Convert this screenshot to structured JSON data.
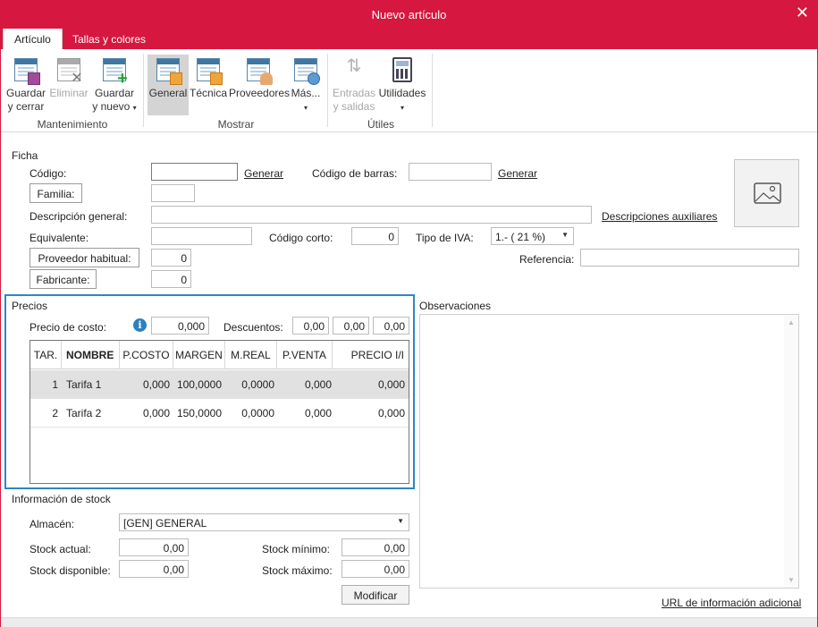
{
  "window": {
    "title": "Nuevo artículo",
    "close_glyph": "✕"
  },
  "tabs": [
    {
      "label": "Artículo",
      "active": true
    },
    {
      "label": "Tallas y colores",
      "active": false
    }
  ],
  "ribbon": {
    "buttons": {
      "guardar_cerrar": {
        "line1": "Guardar",
        "line2": "y cerrar",
        "icon": "save-close-icon"
      },
      "eliminar": {
        "line1": "Eliminar",
        "line2": "",
        "icon": "delete-icon",
        "disabled": true
      },
      "guardar_nuevo": {
        "line1": "Guardar",
        "line2": "y nuevo",
        "caret": "▾",
        "icon": "save-new-icon"
      },
      "general": {
        "line1": "General",
        "icon": "general-icon",
        "selected": true
      },
      "tecnica": {
        "line1": "Técnica",
        "icon": "technical-icon"
      },
      "proveedores": {
        "line1": "Proveedores",
        "icon": "suppliers-icon"
      },
      "mas": {
        "line1": "Más...",
        "caret": "▾",
        "icon": "more-icon"
      },
      "entradas": {
        "line1": "Entradas",
        "line2": "y salidas",
        "icon": "in-out-icon",
        "disabled": true
      },
      "utilidades": {
        "line1": "Utilidades",
        "caret": "▾",
        "icon": "calculator-icon"
      }
    },
    "groups": {
      "mantenimiento": "Mantenimiento",
      "mostrar": "Mostrar",
      "utiles": "Útiles"
    }
  },
  "ficha": {
    "section": "Ficha",
    "codigo_label": "Código:",
    "codigo_value": "",
    "generar": "Generar",
    "codigo_barras_label": "Código de barras:",
    "codigo_barras_value": "",
    "generar2": "Generar",
    "familia_button": "Familia:",
    "familia_value": "",
    "descripcion_label": "Descripción general:",
    "descripcion_value": "",
    "descripciones_aux": "Descripciones auxiliares",
    "equivalente_label": "Equivalente:",
    "equivalente_value": "",
    "codigo_corto_label": "Código corto:",
    "codigo_corto_value": "0",
    "tipo_iva_label": "Tipo de IVA:",
    "tipo_iva_value": "1.- ( 21 %)",
    "proveedor_button": "Proveedor habitual:",
    "proveedor_value": "0",
    "referencia_label": "Referencia:",
    "referencia_value": "",
    "fabricante_button": "Fabricante:",
    "fabricante_value": "0",
    "image_icon": "image-placeholder-icon"
  },
  "precios": {
    "section": "Precios",
    "precio_costo_label": "Precio de costo:",
    "precio_costo_value": "0,000",
    "info_glyph": "i",
    "descuentos_label": "Descuentos:",
    "descuentos": [
      "0,00",
      "0,00",
      "0,00"
    ],
    "columns": [
      "TAR.",
      "NOMBRE",
      "P.COSTO",
      "MARGEN",
      "M.REAL",
      "P.VENTA",
      "PRECIO I/I"
    ],
    "rows": [
      {
        "tar": "1",
        "nombre": "Tarifa 1",
        "pcosto": "0,000",
        "margen": "100,0000",
        "mreal": "0,0000",
        "pventa": "0,000",
        "precio_ii": "0,000"
      },
      {
        "tar": "2",
        "nombre": "Tarifa 2",
        "pcosto": "0,000",
        "margen": "150,0000",
        "mreal": "0,0000",
        "pventa": "0,000",
        "precio_ii": "0,000"
      }
    ]
  },
  "observaciones": {
    "section": "Observaciones",
    "value": ""
  },
  "stock": {
    "section": "Información de stock",
    "almacen_label": "Almacén:",
    "almacen_value": "[GEN] GENERAL",
    "stock_actual_label": "Stock actual:",
    "stock_actual_value": "0,00",
    "stock_disponible_label": "Stock disponible:",
    "stock_disponible_value": "0,00",
    "stock_minimo_label": "Stock mínimo:",
    "stock_minimo_value": "0,00",
    "stock_maximo_label": "Stock máximo:",
    "stock_maximo_value": "0,00",
    "modificar_button": "Modificar"
  },
  "url_info_link": "URL de información adicional"
}
